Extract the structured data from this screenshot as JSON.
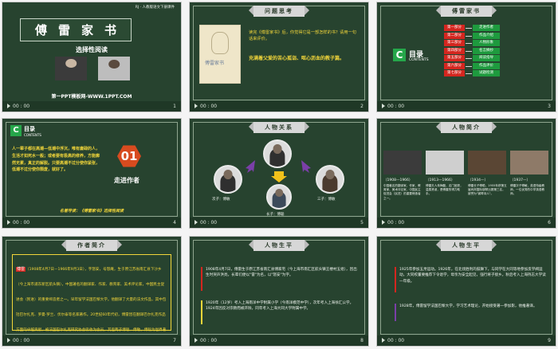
{
  "footer": {
    "time": "00 : 00"
  },
  "slides": [
    {
      "num": "1",
      "header": "RJ · 人教版语文下册课件",
      "title": "傅雷家书",
      "subtitle": "选择性阅读",
      "link": "第一PPT模板网-WWW.1PPT.COM"
    },
    {
      "num": "2",
      "banner": "问题思考",
      "book_cover": "傅雷家书",
      "question": "读完《傅雷家书》后，你觉得它是一部怎样的书？请用一句话来评价。",
      "answer": "充满着父爱的苦心孤诣、呕心沥血的教子篇。"
    },
    {
      "num": "3",
      "banner": "傅雷家书",
      "toc_title": "目录",
      "toc_sub": "CONTENTS",
      "items": [
        {
          "part": "第一部分",
          "label": "走进作者"
        },
        {
          "part": "第二部分",
          "label": "作品介绍"
        },
        {
          "part": "第三部分",
          "label": "人物形象"
        },
        {
          "part": "第四部分",
          "label": "名言摘抄"
        },
        {
          "part": "第五部分",
          "label": "阅读指导"
        },
        {
          "part": "第六部分",
          "label": "作品评价"
        },
        {
          "part": "第七部分",
          "label": "试题检测"
        }
      ]
    },
    {
      "num": "4",
      "toc_title": "目录",
      "toc_sub": "CONTENTS",
      "poem": "人一辈子都在高潮—低潮中浮沉，唯有庸碌的人，生活才如死水一般；或者要有极高的修养，方能廓然无累，真正的解脱。只要高潮不过分使你紧张，低潮不过分使你颓废，就好了。",
      "chapter_no": "01",
      "chapter_title": "走进作者",
      "guide": "名著导读：《傅雷家书》选择性阅读"
    },
    {
      "num": "5",
      "banner": "人物关系",
      "labels": {
        "left": "次子：傅敏",
        "center": "傅雷",
        "right": "三子：傅敏",
        "bottom": "长子：傅聪"
      }
    },
    {
      "num": "6",
      "banner": "人物简介",
      "people": [
        {
          "years": "（1908—1966）",
          "desc": "中国著名的翻译家、作家、教育家、美术评论家，中国民主促进会（民进）的重要缔造者之一。"
        },
        {
          "years": "（1913—1966）",
          "desc": "傅雷夫人朱梅馥，名门闺秀，温柔贤淑，是傅雷的得力助手。"
        },
        {
          "years": "（1934—）",
          "desc": "傅雷长子傅聪，1955年获第五届肖邦国际钢琴比赛第三名，被誉为\"钢琴诗人\"。"
        },
        {
          "years": "（1937—）",
          "desc": "傅雷次子傅敏，英语特级教师，一位优秀的中学英语教师。"
        }
      ]
    },
    {
      "num": "7",
      "banner": "作者简介",
      "name": "傅雷",
      "bio": "（1908年4月7日－1966年9月3日），字怒安，号怒庵，生于原江苏省南汇县下沙乡（今上海市浦东新区航头镇），中国著名的翻译家、作家、教育家、美术评论家，中国民主促进会（民进）的重要缔造者之一。早年留学法国巴黎大学。他翻译了大量的法文作品，其中包括巴尔扎克、罗曼·罗兰、伏尔泰等名家著作。20世纪60年代初，傅雷因在翻译巴尔扎克作品方面的卓越贡献，被法国巴尔扎克研究协会吸收为会员。其后两子傅聪、傅敏，傅聪为世界著名钢琴大师，傅敏为英语教师。他的全部译作，现经家属授权，交由安徽人民出版社编成《傅雷译文集》。"
    },
    {
      "num": "8",
      "banner": "人物生平",
      "events": [
        "1908年4月7日，傅雷生于原江苏省南汇县傅家宅（今上海市南汇区航头镇王楼村五组），因出生时哭声洪亮，长辈们便以\"雷\"为名，以\"怒安\"为字。",
        "1920年（12岁）考入上海南洋中学附属小学（今南洋模范中学），次年考入上海徐汇公学。1924年因反对宗教而被开除，同年考入上海大同大学附属中学。"
      ]
    },
    {
      "num": "9",
      "banner": "人物生平",
      "events": [
        "1925年参加五卅运动。1926年，在北伐胜利的鼓舞下，与同学在大同等地参加反学阀运动，大同校董要推荐下令退学，母亲为安全起见，强行将子接乡。秋后考入上海持志大学读一年级。",
        "1928年，傅雷留学法国巴黎大学，学习艺术理论，开始接受著一参加影，他推著译。"
      ]
    }
  ]
}
